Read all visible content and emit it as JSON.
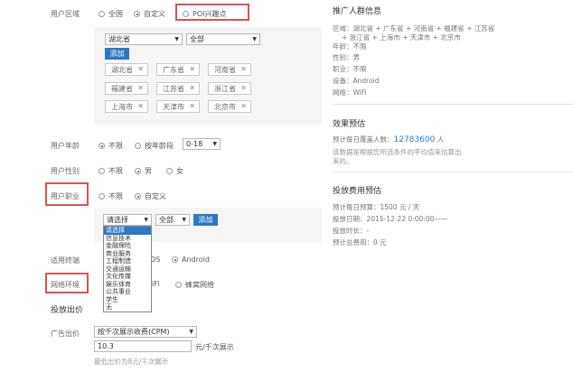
{
  "region": {
    "label": "用户区域",
    "options": [
      "全国",
      "自定义",
      "POI兴趣点"
    ],
    "selected": 1,
    "province_select": "湖北省",
    "city_select": "全部",
    "add_label": "添加",
    "chips": [
      "湖北省",
      "广东省",
      "河南省",
      "福建省",
      "江苏省",
      "浙江省",
      "上海市",
      "天津市",
      "北京市"
    ]
  },
  "age": {
    "label": "用户年龄",
    "options": [
      "不限",
      "按年龄段"
    ],
    "selected": 0,
    "range": "0-18"
  },
  "gender": {
    "label": "用户性别",
    "options": [
      "不限",
      "男",
      "女"
    ],
    "selected": 1
  },
  "occupation": {
    "label": "用户职业",
    "options": [
      "不限",
      "自定义"
    ],
    "selected": 1,
    "select_value": "请选择",
    "sub_select": "全部",
    "add_label": "添加",
    "dropdown_items": [
      "请选择",
      "信息技术",
      "金融保险",
      "商业服务",
      "工程制造",
      "交通运输",
      "文化传媒",
      "娱乐体育",
      "公共事业",
      "学生",
      "无"
    ]
  },
  "terminal": {
    "label": "适用终端",
    "options": [
      "OS",
      "Android"
    ],
    "selected": 1
  },
  "network": {
    "label": "网络环境",
    "options": [
      "iFi",
      "蜂窝网络"
    ],
    "selected": 0
  },
  "bid": {
    "section_title": "投放出价",
    "label": "广告出价",
    "mode": "按千次展示收费(CPM)",
    "value": "10.3",
    "unit": "元/千次展示",
    "hint": "最低出价为8元/千次展示"
  },
  "right": {
    "audience_title": "推广人群信息",
    "region_line1": "区域：湖北省 + 广东省 + 河南省 + 福建省 + 江苏省",
    "region_line2": "+ 浙江省 + 上海市 + 天津市 + 北京市",
    "age_line": "年龄：不限",
    "gender_line": "性别：男",
    "occupation_line": "职业：不限",
    "device_line": "设备：Android",
    "network_line": "网络：WiFi",
    "effect_title": "效果预估",
    "exposure_prefix": "预计每日覆盖人数：",
    "exposure_value": "12783600",
    "exposure_unit": "人",
    "note_line1": "该数据是根据您所选条件的平均值来估算出",
    "note_line2": "来的。",
    "cost_title": "投放费用预估",
    "budget_line": "预计每日预算：1500 元 / 天",
    "date_line": "投放日期：2015-12-22 0:00:00——",
    "duration_line": "投放时长：-",
    "total_line": "预计总费用：0 元"
  },
  "colors": {
    "accent": "#2b78c4",
    "highlight": "#d9534f",
    "panel": "#f5f5f5"
  }
}
